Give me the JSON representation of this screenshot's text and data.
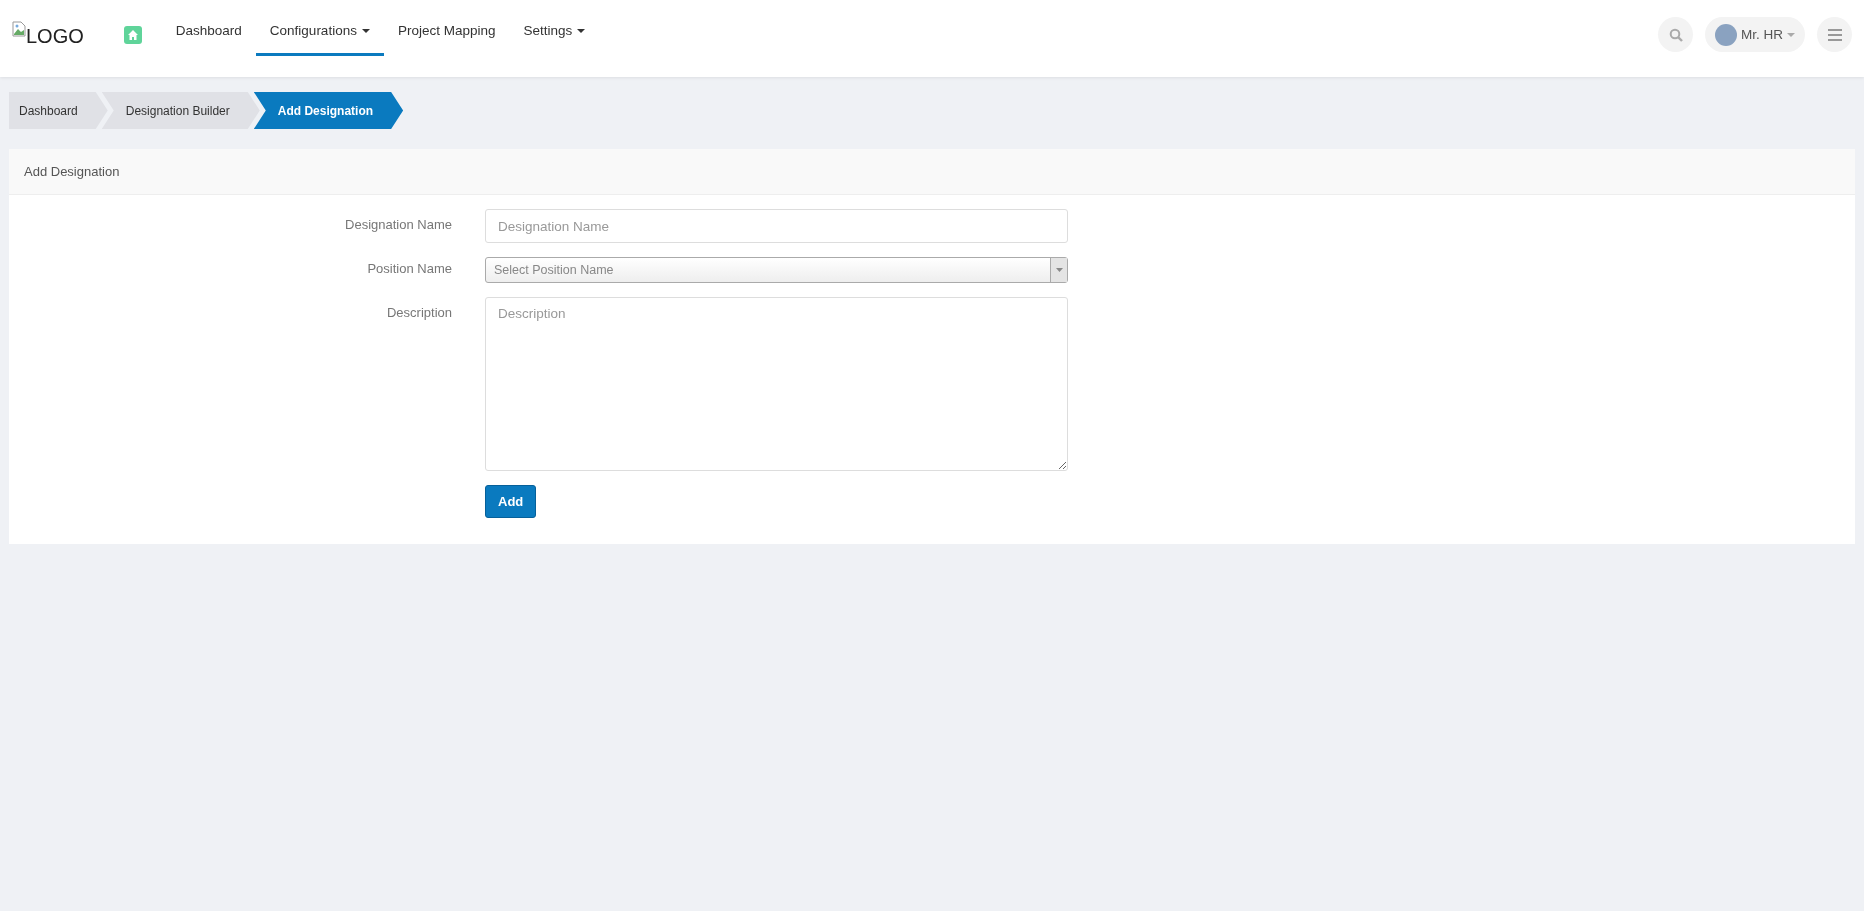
{
  "logo": {
    "alt_text": "LOGO"
  },
  "nav": [
    {
      "label": "Dashboard",
      "selected": false,
      "dropdown": false
    },
    {
      "label": "Configurations",
      "selected": true,
      "dropdown": true
    },
    {
      "label": "Project Mapping",
      "selected": false,
      "dropdown": false
    },
    {
      "label": "Settings",
      "selected": false,
      "dropdown": true
    }
  ],
  "user": {
    "name": "Mr. HR"
  },
  "breadcrumbs": [
    {
      "label": "Dashboard",
      "selected": false
    },
    {
      "label": "Designation Builder",
      "selected": false
    },
    {
      "label": "Add Designation",
      "selected": true
    }
  ],
  "panel": {
    "title": "Add Designation"
  },
  "form": [
    {
      "kind": "text",
      "label": "Designation Name",
      "placeholder": "Designation Name"
    },
    {
      "kind": "select",
      "label": "Position Name",
      "placeholder": "Select Position Name"
    },
    {
      "kind": "textarea",
      "label": "Description",
      "placeholder": "Description"
    }
  ],
  "submit": "Add"
}
